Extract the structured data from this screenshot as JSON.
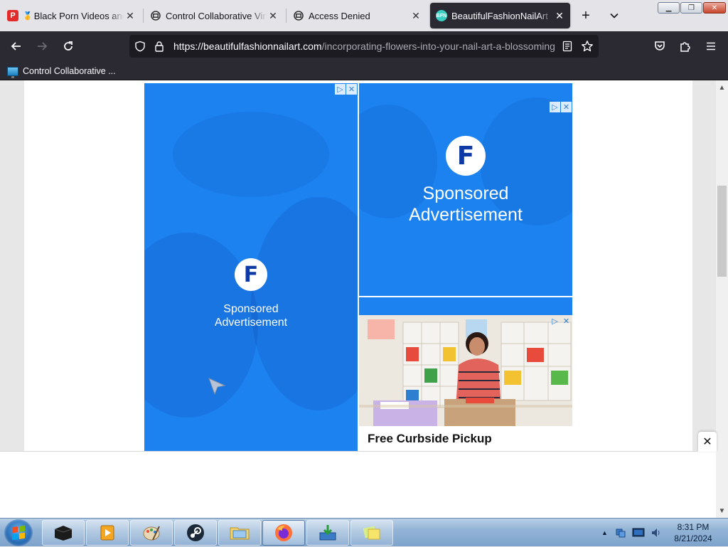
{
  "browser": {
    "tabs": [
      {
        "title": "Black Porn Videos and H",
        "favicon": "p-badge-icon",
        "active": false
      },
      {
        "title": "Control Collaborative Virtu",
        "favicon": "remote-desktop-icon",
        "active": false
      },
      {
        "title": "Access Denied",
        "favicon": "remote-desktop-icon",
        "active": false
      },
      {
        "title": "BeautifulFashionNailArt",
        "favicon": "site-logo-icon",
        "active": true
      }
    ],
    "new_tab_label": "+",
    "url_host": "https://beautifulfashionnailart.com",
    "url_path": "/incorporating-flowers-into-your-nail-art-a-blossoming",
    "bookmarks": [
      {
        "label": "Control Collaborative ..."
      }
    ]
  },
  "ads": {
    "left": {
      "brand_letter": "F",
      "text_line1": "Sponsored",
      "text_line2": "Advertisement"
    },
    "top_right": {
      "brand_letter": "F",
      "text_line1": "Sponsored",
      "text_line2": "Advertisement"
    },
    "bottom_right": {
      "caption": "Free Curbside Pickup"
    }
  },
  "banner": {
    "close_label": "✕"
  },
  "taskbar": {
    "time": "8:31 PM",
    "date": "8/21/2024"
  },
  "colors": {
    "ad_blue": "#1b82ef",
    "browser_dark": "#2b2a33",
    "tabstrip": "#e3e3e8"
  }
}
